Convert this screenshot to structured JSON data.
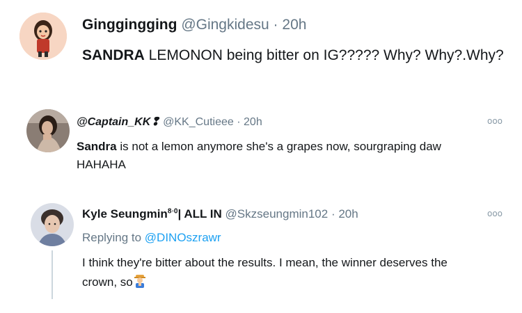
{
  "tweets": [
    {
      "display_name": "Ginggingging",
      "handle": "@Gingkidesu",
      "separator": "·",
      "time": "20h",
      "text_bold": "SANDRA",
      "text_rest": " LEMONON being bitter on IG????? Why? Why?.Why?"
    },
    {
      "display_name": "@Captain_KK",
      "name_glyph": "❢",
      "handle": "@KK_Cutieee",
      "separator": "·",
      "time": "20h",
      "text_bold": "Sandra",
      "text_rest_line1": " is not a lemon anymore she's a grapes now, sourgraping daw",
      "text_line2": "HAHAHA",
      "more": "ooo"
    },
    {
      "display_name": "Kyle Seungmin",
      "name_sup": "8◦0",
      "name_suffix": "| ALL IN",
      "handle": "@Skzseungmin102",
      "separator": "·",
      "time": "20h",
      "replying_prefix": "Replying to ",
      "replying_to": "@DINOszrawr",
      "text_line1": "I think they're bitter about the results. I mean, the winner deserves the",
      "text_line2": "crown, so",
      "more": "ooo"
    }
  ],
  "colors": {
    "text": "#14171a",
    "muted": "#657786",
    "link": "#1da1f2",
    "thread_line": "#ccd6dd"
  }
}
